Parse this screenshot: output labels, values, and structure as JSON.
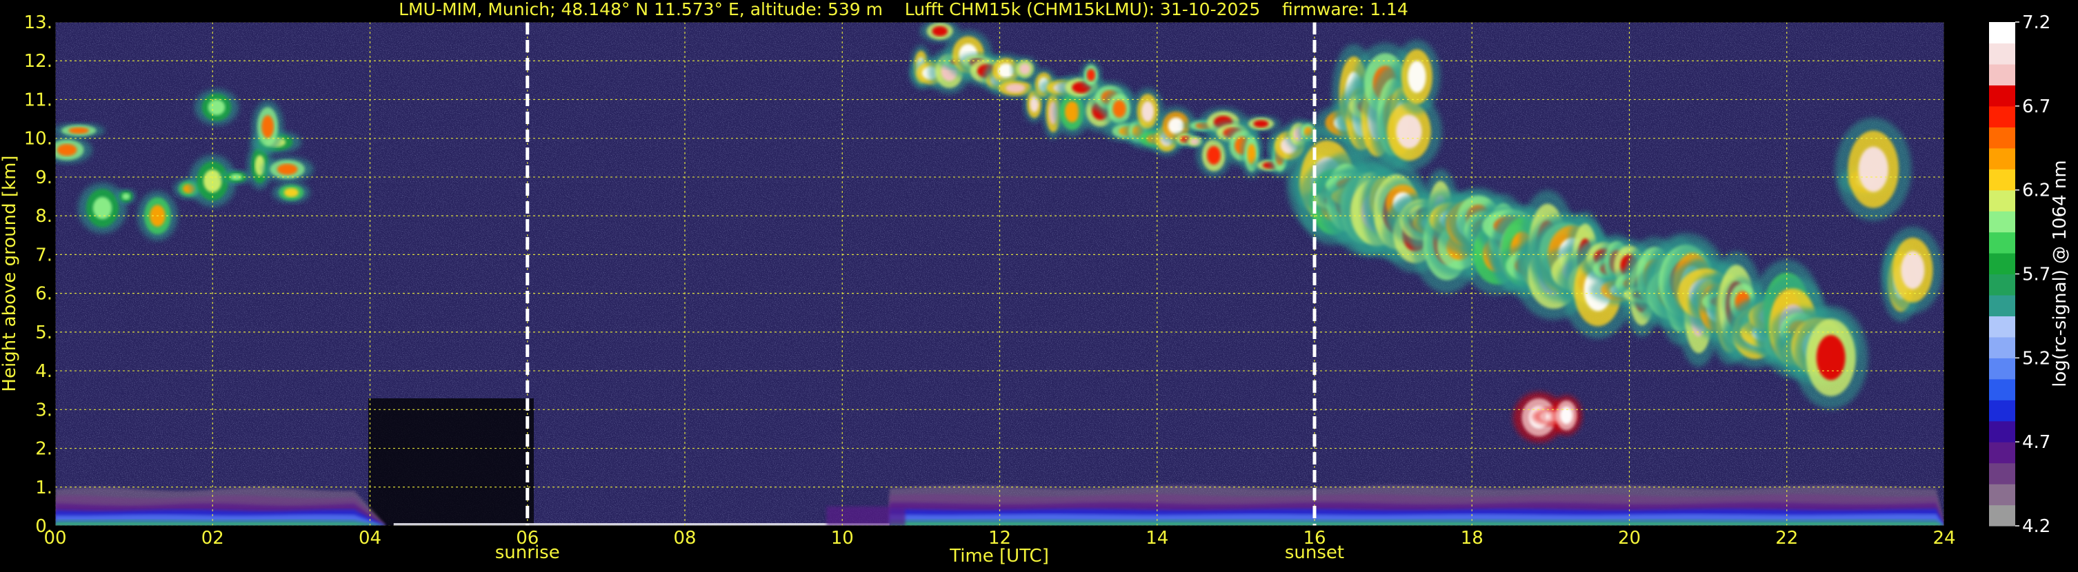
{
  "chart_data": {
    "type": "heatmap",
    "title": "LMU-MIM, Munich; 48.148° N 11.573° E, altitude: 539 m    Lufft CHM15k (CHM15kLMU): 31-10-2025    firmware: 1.14",
    "xlabel": "Time [UTC]",
    "ylabel": "Height above ground [km]",
    "colorbar_label": "log(rc-signal) @ 1064 nm",
    "xlim": [
      0,
      24
    ],
    "ylim": [
      0,
      13
    ],
    "clim": [
      4.2,
      7.2
    ],
    "grid": true,
    "x_ticks": [
      {
        "value": 0,
        "label": "00"
      },
      {
        "value": 2,
        "label": "02"
      },
      {
        "value": 4,
        "label": "04"
      },
      {
        "value": 6,
        "label": "06"
      },
      {
        "value": 8,
        "label": "08"
      },
      {
        "value": 10,
        "label": "10"
      },
      {
        "value": 12,
        "label": "12"
      },
      {
        "value": 14,
        "label": "14"
      },
      {
        "value": 16,
        "label": "16"
      },
      {
        "value": 18,
        "label": "18"
      },
      {
        "value": 20,
        "label": "20"
      },
      {
        "value": 22,
        "label": "22"
      },
      {
        "value": 24,
        "label": "24"
      }
    ],
    "y_ticks": [
      {
        "value": 0,
        "label": "0."
      },
      {
        "value": 1,
        "label": "1."
      },
      {
        "value": 2,
        "label": "2."
      },
      {
        "value": 3,
        "label": "3."
      },
      {
        "value": 4,
        "label": "4."
      },
      {
        "value": 5,
        "label": "5."
      },
      {
        "value": 6,
        "label": "6."
      },
      {
        "value": 7,
        "label": "7."
      },
      {
        "value": 8,
        "label": "8."
      },
      {
        "value": 9,
        "label": "9."
      },
      {
        "value": 10,
        "label": "10."
      },
      {
        "value": 11,
        "label": "11."
      },
      {
        "value": 12,
        "label": "12."
      },
      {
        "value": 13,
        "label": "13."
      }
    ],
    "colorbar_ticks": [
      {
        "value": 4.2,
        "label": "4.2"
      },
      {
        "value": 4.7,
        "label": "4.7"
      },
      {
        "value": 5.2,
        "label": "5.2"
      },
      {
        "value": 5.7,
        "label": "5.7"
      },
      {
        "value": 6.2,
        "label": "6.2"
      },
      {
        "value": 6.7,
        "label": "6.7"
      },
      {
        "value": 7.2,
        "label": "7.2"
      }
    ],
    "markers": [
      {
        "time": 6.0,
        "label": "sunrise"
      },
      {
        "time": 16.0,
        "label": "sunset"
      }
    ],
    "colormap": [
      "#9b9b9b",
      "#8a6f8f",
      "#6e3f83",
      "#5a1a8a",
      "#3a0d9c",
      "#1a2cdb",
      "#2a5cf0",
      "#5b86f5",
      "#8cabf7",
      "#b0c7fa",
      "#2f9c8e",
      "#22a05a",
      "#18a83a",
      "#3fd25a",
      "#8ff08a",
      "#d4f06a",
      "#ffd21a",
      "#ffa000",
      "#ff6a00",
      "#ff2000",
      "#e00000",
      "#f4c4c4",
      "#f7e1e1",
      "#ffffff"
    ],
    "background_color": "#2a2560",
    "features": [
      {
        "name": "boundary layer aerosol",
        "t_start": 0.0,
        "t_end": 24.0,
        "h_top": 0.9,
        "value_range": [
          4.4,
          4.9
        ]
      },
      {
        "name": "morning cirrus",
        "t_start": 0.0,
        "t_end": 3.1,
        "h_range": [
          7.6,
          11.0
        ],
        "value_range": [
          5.5,
          6.5
        ]
      },
      {
        "name": "afternoon cirrus (descending)",
        "t_start": 10.8,
        "t_end": 23.5,
        "h_range": [
          3.8,
          12.6
        ],
        "value_range": [
          5.5,
          7.2
        ]
      },
      {
        "name": "low cloud patch",
        "t_start": 18.7,
        "t_end": 19.3,
        "h_range": [
          2.7,
          2.9
        ],
        "value_range": [
          6.7,
          7.2
        ]
      }
    ]
  }
}
